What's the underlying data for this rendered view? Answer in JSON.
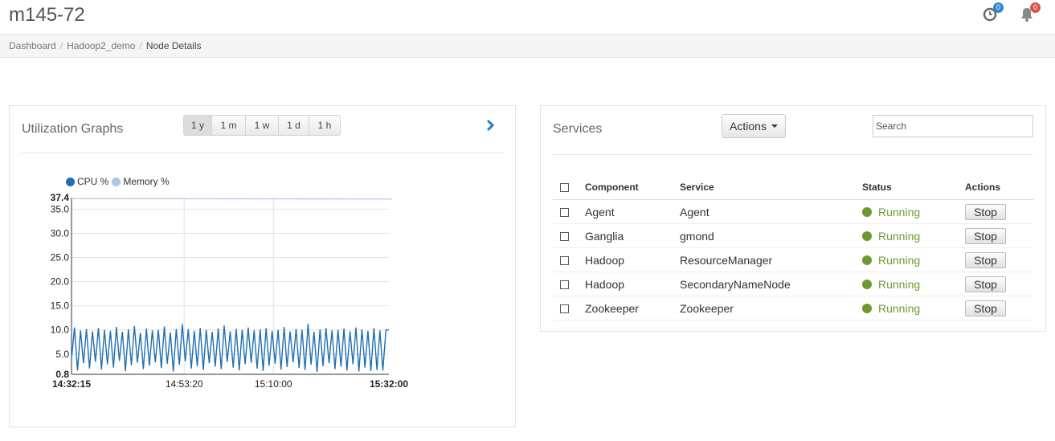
{
  "header": {
    "title": "m145-72",
    "clock_badge": "0",
    "bell_badge": "0",
    "colors": {
      "clock_badge": "#2d87d0",
      "bell_badge": "#d9534f"
    }
  },
  "breadcrumb": {
    "items": [
      "Dashboard",
      "Hadoop2_demo"
    ],
    "active": "Node Details"
  },
  "utilization": {
    "title": "Utilization Graphs",
    "ranges": [
      "1 y",
      "1 m",
      "1 w",
      "1 d",
      "1 h"
    ],
    "selected_range": "1 y",
    "legend": [
      {
        "name": "CPU %",
        "color": "#1f6fb2"
      },
      {
        "name": "Memory %",
        "color": "#aec8e6"
      }
    ]
  },
  "chart_data": {
    "type": "line",
    "x_labels": [
      "14:32:15",
      "14:53:20",
      "15:10:00",
      "15:32:00"
    ],
    "y_labels": [
      "37.4",
      "35.0",
      "30.0",
      "25.0",
      "20.0",
      "15.0",
      "10.0",
      "5.0",
      "0.8"
    ],
    "ylim": [
      0.8,
      37.4
    ],
    "grid": true,
    "legend_position": "top-left",
    "series": [
      {
        "name": "CPU %",
        "color": "#1f6fb2",
        "pattern_high": [
          10.5,
          9.9,
          10.2,
          9.7,
          10.4,
          10.0,
          9.8,
          10.6,
          9.6,
          10.1,
          10.8,
          9.4,
          10.3,
          9.9,
          10.0,
          10.7,
          9.5,
          10.2,
          11.2,
          10.1,
          9.8,
          10.4,
          10.0,
          9.6,
          10.3,
          10.9,
          9.7,
          10.2,
          10.0,
          10.5,
          9.9,
          10.1,
          10.4,
          9.8,
          10.0,
          10.6,
          9.7,
          10.2,
          10.0,
          11.3,
          9.6,
          10.1,
          10.4,
          9.9,
          10.0,
          10.3,
          9.7,
          10.5,
          10.1,
          9.8,
          10.4,
          9.9,
          10.0
        ],
        "pattern_low": [
          3.9,
          1.6,
          3.1,
          2.0,
          3.4,
          1.8,
          2.9,
          2.2,
          3.6,
          1.5,
          2.7,
          3.2,
          1.9,
          2.6,
          3.3,
          2.1,
          3.0,
          1.4,
          2.8,
          3.5,
          2.0,
          2.5,
          1.7,
          3.1,
          2.4,
          1.9,
          3.4,
          2.2,
          1.6,
          2.9,
          3.2,
          2.0,
          1.5,
          2.6,
          3.0,
          1.8,
          2.3,
          3.3,
          2.1,
          1.7,
          2.8,
          1.3,
          2.5,
          3.1,
          1.9,
          2.4,
          1.6,
          2.9,
          1.4,
          2.2,
          1.5,
          1.7,
          1.6
        ]
      },
      {
        "name": "Memory %",
        "color": "#aec8e6",
        "start": 37.2,
        "end": 37.1
      }
    ]
  },
  "services": {
    "title": "Services",
    "actions_label": "Actions",
    "search_placeholder": "Search",
    "columns": [
      "Component",
      "Service",
      "Status",
      "Actions"
    ],
    "rows": [
      {
        "component": "Agent",
        "service": "Agent",
        "status": "Running",
        "action": "Stop"
      },
      {
        "component": "Ganglia",
        "service": "gmond",
        "status": "Running",
        "action": "Stop"
      },
      {
        "component": "Hadoop",
        "service": "ResourceManager",
        "status": "Running",
        "action": "Stop"
      },
      {
        "component": "Hadoop",
        "service": "SecondaryNameNode",
        "status": "Running",
        "action": "Stop"
      },
      {
        "component": "Zookeeper",
        "service": "Zookeeper",
        "status": "Running",
        "action": "Stop"
      }
    ],
    "status_color": "#6b9b2e"
  }
}
